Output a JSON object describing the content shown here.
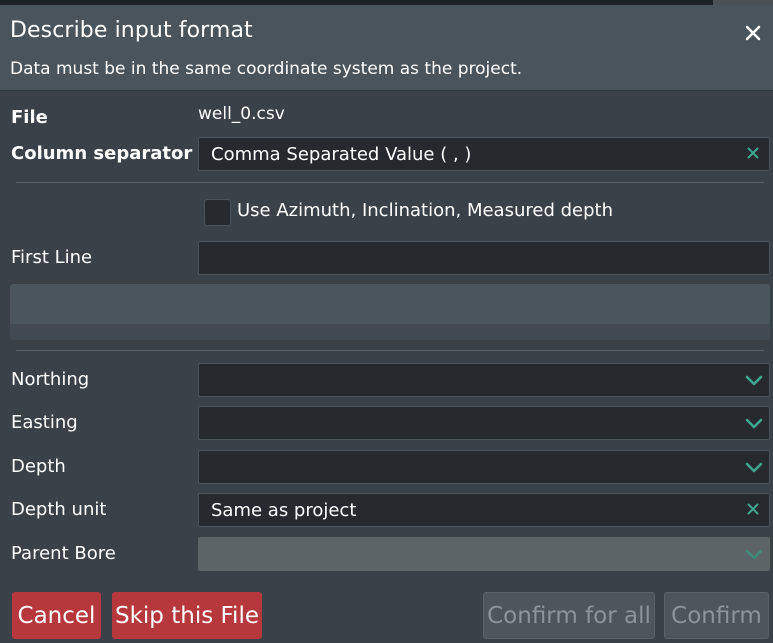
{
  "dialog": {
    "title": "Describe input format",
    "subtitle": "Data must be in the same coordinate system as the project."
  },
  "file": {
    "label": "File",
    "value": "well_0.csv"
  },
  "column_separator": {
    "label": "Column separator",
    "value": "Comma Separated Value ( , )"
  },
  "azimuth_option": {
    "label": "Use Azimuth, Inclination, Measured depth",
    "checked": false
  },
  "first_line": {
    "label": "First Line",
    "value": ""
  },
  "northing": {
    "label": "Northing",
    "value": ""
  },
  "easting": {
    "label": "Easting",
    "value": ""
  },
  "depth": {
    "label": "Depth",
    "value": ""
  },
  "depth_unit": {
    "label": "Depth unit",
    "value": "Same as project"
  },
  "parent_bore": {
    "label": "Parent Bore",
    "value": ""
  },
  "buttons": {
    "cancel": "Cancel",
    "skip": "Skip this File",
    "confirm_all": "Confirm for all",
    "confirm": "Confirm"
  },
  "colors": {
    "accent_teal": "#3fa58f",
    "danger": "#b7383c",
    "header_bg": "#4a545d",
    "body_bg": "#3a4148"
  },
  "icons": {
    "close": "close-icon",
    "clear": "clear-x-icon",
    "dropdown": "chevron-down-icon"
  }
}
